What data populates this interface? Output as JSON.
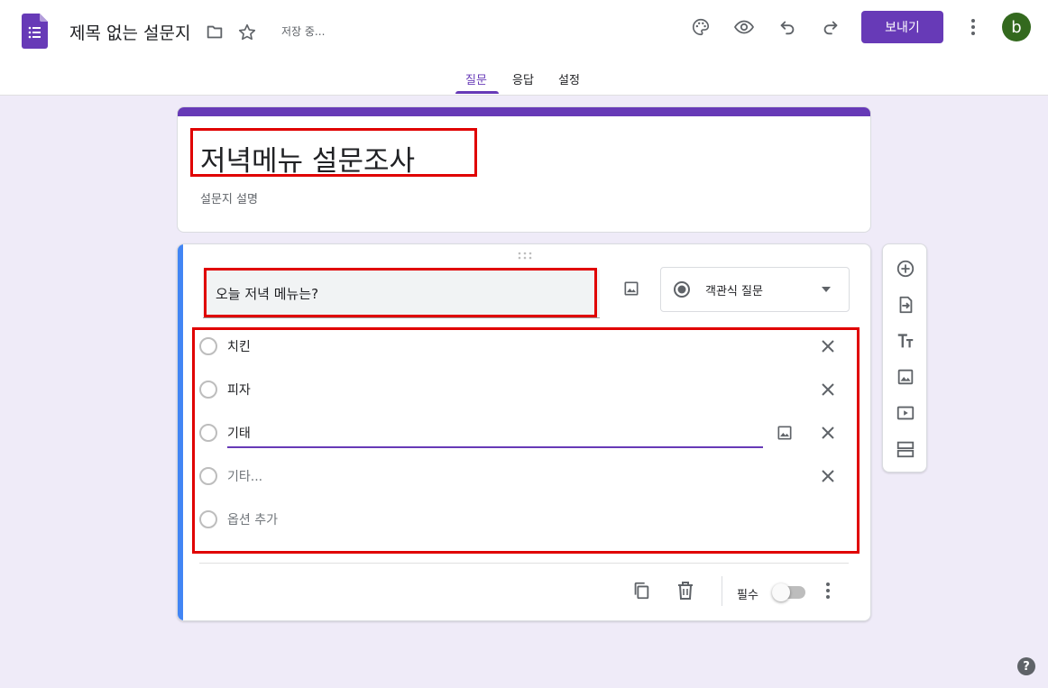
{
  "header": {
    "doc_title": "제목 없는 설문지",
    "saving_status": "저장 중...",
    "send_label": "보내기",
    "avatar_letter": "b"
  },
  "tabs": [
    {
      "label": "질문",
      "active": true
    },
    {
      "label": "응답",
      "active": false
    },
    {
      "label": "설정",
      "active": false
    }
  ],
  "form": {
    "title": "저녁메뉴 설문조사",
    "description": "설문지 설명"
  },
  "question": {
    "text": "오늘 저녁 메뉴는?",
    "type_label": "객관식 질문",
    "options": [
      {
        "label": "치킨"
      },
      {
        "label": "피자"
      },
      {
        "label": "기태"
      }
    ],
    "other_label": "기타...",
    "add_option_label": "옵션 추가",
    "required_label": "필수",
    "required": false
  },
  "side_toolbar": [
    "add-question-icon",
    "import-questions-icon",
    "add-title-icon",
    "add-image-icon",
    "add-video-icon",
    "add-section-icon"
  ],
  "help_glyph": "?",
  "colors": {
    "accent": "#673ab7",
    "focus_bar": "#4285f4",
    "background": "#efebf8",
    "highlight": "#e00000",
    "avatar": "#33691e"
  }
}
